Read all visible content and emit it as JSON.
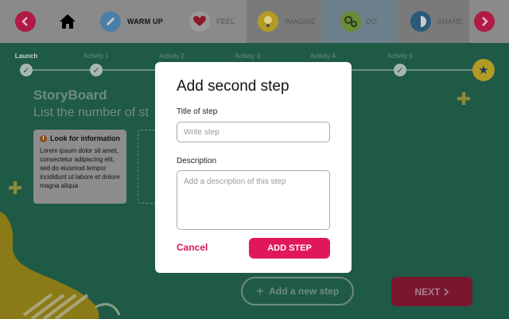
{
  "nav": {
    "tabs": [
      {
        "id": "home",
        "label": "",
        "icon": "home-icon"
      },
      {
        "id": "warmup",
        "label": "WARM UP",
        "icon": "pencil-icon"
      },
      {
        "id": "feel",
        "label": "FEEL",
        "icon": "heart-icon"
      },
      {
        "id": "imagine",
        "label": "IMAGINE",
        "icon": "lightbulb-icon"
      },
      {
        "id": "do",
        "label": "DO",
        "icon": "gears-icon"
      },
      {
        "id": "share",
        "label": "SHARE",
        "icon": "share-icon"
      }
    ],
    "prev_icon": "chevron-left-icon",
    "next_icon": "chevron-right-icon"
  },
  "progress": {
    "steps": [
      "Launch",
      "Activity 1",
      "Activity 2",
      "Activity 3",
      "Activity 4",
      "Activity 5"
    ],
    "end_icon": "star-icon"
  },
  "page": {
    "title": "StoryBoard",
    "subtitle": "List the number of st",
    "info_card": {
      "heading": "Look for information",
      "body": "Lorem ipsum dolor sit amet, consectetur adipiscing elit, sed do eiusmod tempor incididunt ut labore et dolore magna aliqua"
    },
    "add_new_step": "Add a new step",
    "next": "NEXT"
  },
  "modal": {
    "title": "Add second step",
    "title_label": "Title of step",
    "title_placeholder": "Write step",
    "description_label": "Description",
    "description_placeholder": "Add a description of this step",
    "cancel": "Cancel",
    "submit": "ADD STEP"
  },
  "colors": {
    "background": "#1f5a47",
    "accent": "#e0185a",
    "nav": "#8a8a8a"
  }
}
